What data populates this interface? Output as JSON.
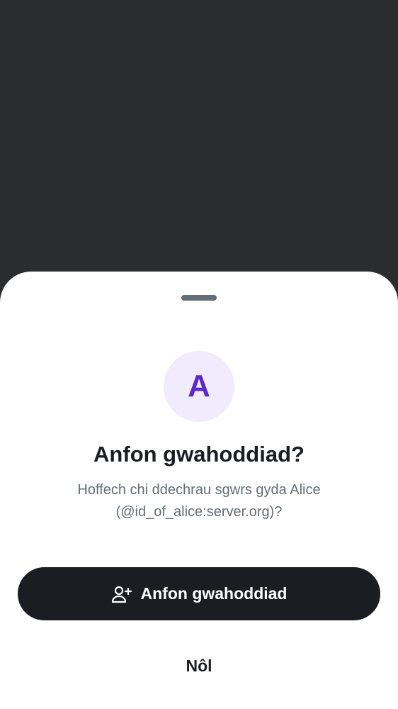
{
  "dialog": {
    "avatar_initial": "A",
    "title": "Anfon gwahoddiad?",
    "subtitle_line1": "Hoffech chi ddechrau sgwrs gyda Alice",
    "subtitle_line2": "(@id_of_alice:server.org)?",
    "primary_button": {
      "icon": "user-add-icon",
      "label": "Anfon gwahoddiad"
    },
    "back_button_label": "Nôl"
  },
  "colors": {
    "scrim": "#2b2c2e",
    "sheet": "#ffffff",
    "handle": "#656d77",
    "avatar_bg": "#f1ecfd",
    "avatar_text": "#5a27cc",
    "primary_text": "#1b1d22",
    "secondary_text": "#656d77",
    "button_bg": "#1b1d22",
    "button_text": "#ffffff"
  }
}
